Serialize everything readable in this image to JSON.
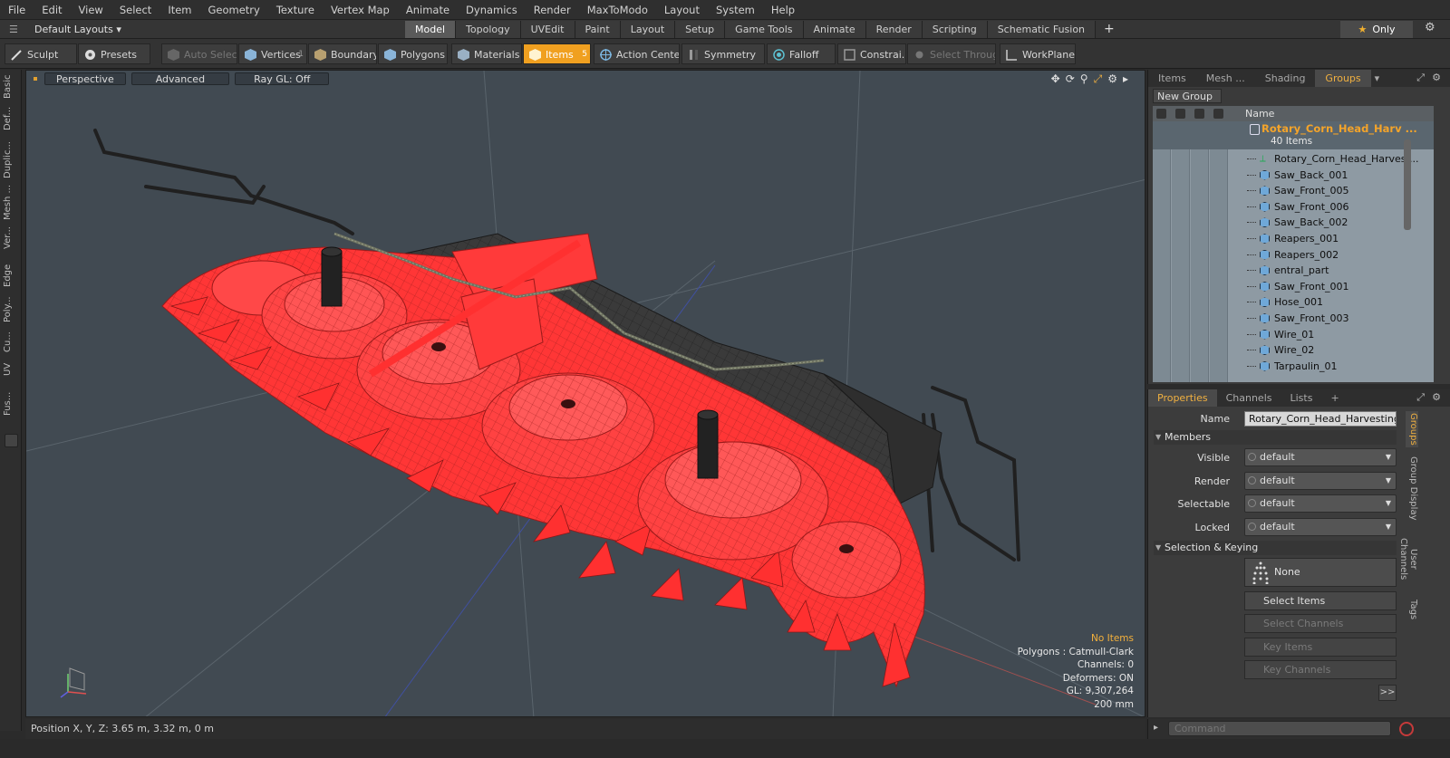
{
  "menu": [
    "File",
    "Edit",
    "View",
    "Select",
    "Item",
    "Geometry",
    "Texture",
    "Vertex Map",
    "Animate",
    "Dynamics",
    "Render",
    "MaxToModo",
    "Layout",
    "System",
    "Help"
  ],
  "layout_bar": {
    "layout_name": "Default Layouts",
    "tabs": [
      {
        "label": "Model",
        "active": true
      },
      {
        "label": "Topology"
      },
      {
        "label": "UVEdit"
      },
      {
        "label": "Paint"
      },
      {
        "label": "Layout"
      },
      {
        "label": "Setup"
      },
      {
        "label": "Game Tools"
      },
      {
        "label": "Animate"
      },
      {
        "label": "Render"
      },
      {
        "label": "Scripting"
      },
      {
        "label": "Schematic Fusion"
      }
    ],
    "only_label": "Only"
  },
  "toolbar": {
    "sculpt": "Sculpt",
    "presets": "Presets",
    "auto_select": "Auto Select",
    "vertices": "Vertices",
    "vertices_count": "1",
    "boundary": "Boundary",
    "polygons": "Polygons",
    "materials": "Materials",
    "items": "Items",
    "items_count": "5",
    "action_center": "Action Center",
    "symmetry": "Symmetry",
    "falloff": "Falloff",
    "constraints": "Constrai...",
    "select_through": "Select Through",
    "workplane": "WorkPlane"
  },
  "left_tabs": [
    "Basic",
    "Def...",
    "Duplic...",
    "Mesh ...",
    "Ver...",
    "Edge",
    "Poly...",
    "Cu...",
    "UV",
    "Fus..."
  ],
  "viewport": {
    "view_mode": "Perspective",
    "shading": "Advanced",
    "raygl": "Ray GL: Off",
    "info": {
      "no_items": "No Items",
      "polygons": "Polygons : Catmull-Clark",
      "channels": "Channels: 0",
      "deformers": "Deformers: ON",
      "gl": "GL: 9,307,264",
      "scale": "200 mm"
    },
    "colors": {
      "background": "#414a52",
      "red": "#ff3b3b",
      "dark": "#3a3a3a"
    }
  },
  "status": {
    "position": "Position X, Y, Z:  3.65 m, 3.32 m, 0 m"
  },
  "items_panel": {
    "tabs": [
      {
        "label": "Items"
      },
      {
        "label": "Mesh ..."
      },
      {
        "label": "Shading"
      },
      {
        "label": "Groups",
        "active": true
      }
    ],
    "new_group": "New Group",
    "name_header": "Name",
    "group": {
      "name": "Rotary_Corn_Head_Harv ...",
      "count": "40 Items"
    },
    "items": [
      {
        "label": "Rotary_Corn_Head_Harves ...",
        "type": "locator"
      },
      {
        "label": "Saw_Back_001",
        "type": "mesh"
      },
      {
        "label": "Saw_Front_005",
        "type": "mesh"
      },
      {
        "label": "Saw_Front_006",
        "type": "mesh"
      },
      {
        "label": "Saw_Back_002",
        "type": "mesh"
      },
      {
        "label": "Reapers_001",
        "type": "mesh"
      },
      {
        "label": "Reapers_002",
        "type": "mesh"
      },
      {
        "label": "entral_part",
        "type": "mesh"
      },
      {
        "label": "Saw_Front_001",
        "type": "mesh"
      },
      {
        "label": "Hose_001",
        "type": "mesh"
      },
      {
        "label": "Saw_Front_003",
        "type": "mesh"
      },
      {
        "label": "Wire_01",
        "type": "mesh"
      },
      {
        "label": "Wire_02",
        "type": "mesh"
      },
      {
        "label": "Tarpaulin_01",
        "type": "mesh"
      }
    ]
  },
  "properties": {
    "tabs": [
      {
        "label": "Properties",
        "active": true
      },
      {
        "label": "Channels"
      },
      {
        "label": "Lists"
      }
    ],
    "name_label": "Name",
    "name_value": "Rotary_Corn_Head_Harvesting_I",
    "members_header": "Members",
    "visible_label": "Visible",
    "visible_value": "default",
    "render_label": "Render",
    "render_value": "default",
    "selectable_label": "Selectable",
    "selectable_value": "default",
    "locked_label": "Locked",
    "locked_value": "default",
    "selection_header": "Selection & Keying",
    "none_label": "None",
    "select_items": "Select Items",
    "select_channels": "Select Channels",
    "key_items": "Key Items",
    "key_channels": "Key Channels",
    "more": ">>",
    "side_tabs": [
      "Groups",
      "Group Display",
      "User Channels",
      "Tags"
    ]
  },
  "command": {
    "placeholder": "Command"
  }
}
